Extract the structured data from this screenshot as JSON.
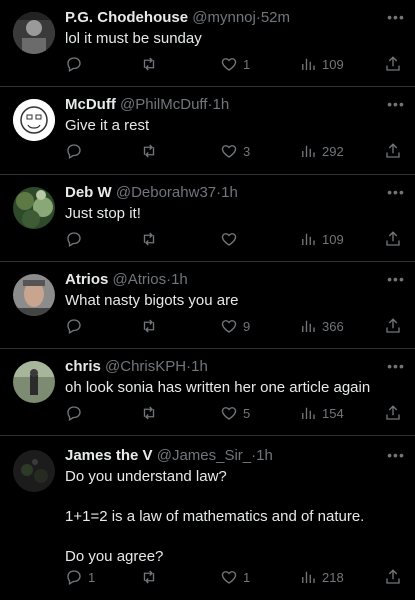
{
  "tweets": [
    {
      "name": "P.G. Chodehouse",
      "handle": "@mynnoj",
      "time": "52m",
      "text": "lol it must be sunday",
      "replies": "",
      "likes": "1",
      "views": "109",
      "avatar": "portrait"
    },
    {
      "name": "McDuff",
      "handle": "@PhilMcDuff",
      "time": "1h",
      "text": "Give it a rest",
      "replies": "",
      "likes": "3",
      "views": "292",
      "avatar": "cartoon"
    },
    {
      "name": "Deb W",
      "handle": "@Deborahw37",
      "time": "1h",
      "text": "Just stop it!",
      "replies": "",
      "likes": "",
      "views": "109",
      "avatar": "foliage"
    },
    {
      "name": "Atrios",
      "handle": "@Atrios",
      "time": "1h",
      "text": "What nasty bigots you are",
      "replies": "",
      "likes": "9",
      "views": "366",
      "avatar": "face"
    },
    {
      "name": "chris",
      "handle": "@ChrisKPH",
      "time": "1h",
      "text": "oh look sonia has written her one article again",
      "replies": "",
      "likes": "5",
      "views": "154",
      "avatar": "outdoor"
    },
    {
      "name": "James the V",
      "handle": "@James_Sir_",
      "time": "1h",
      "text": "Do you understand law?\n\n1+1=2 is a law of mathematics and of nature.\n\nDo you agree?",
      "replies": "1",
      "likes": "1",
      "views": "218",
      "avatar": "dark"
    }
  ],
  "separator": "·",
  "more_glyph": "•••"
}
